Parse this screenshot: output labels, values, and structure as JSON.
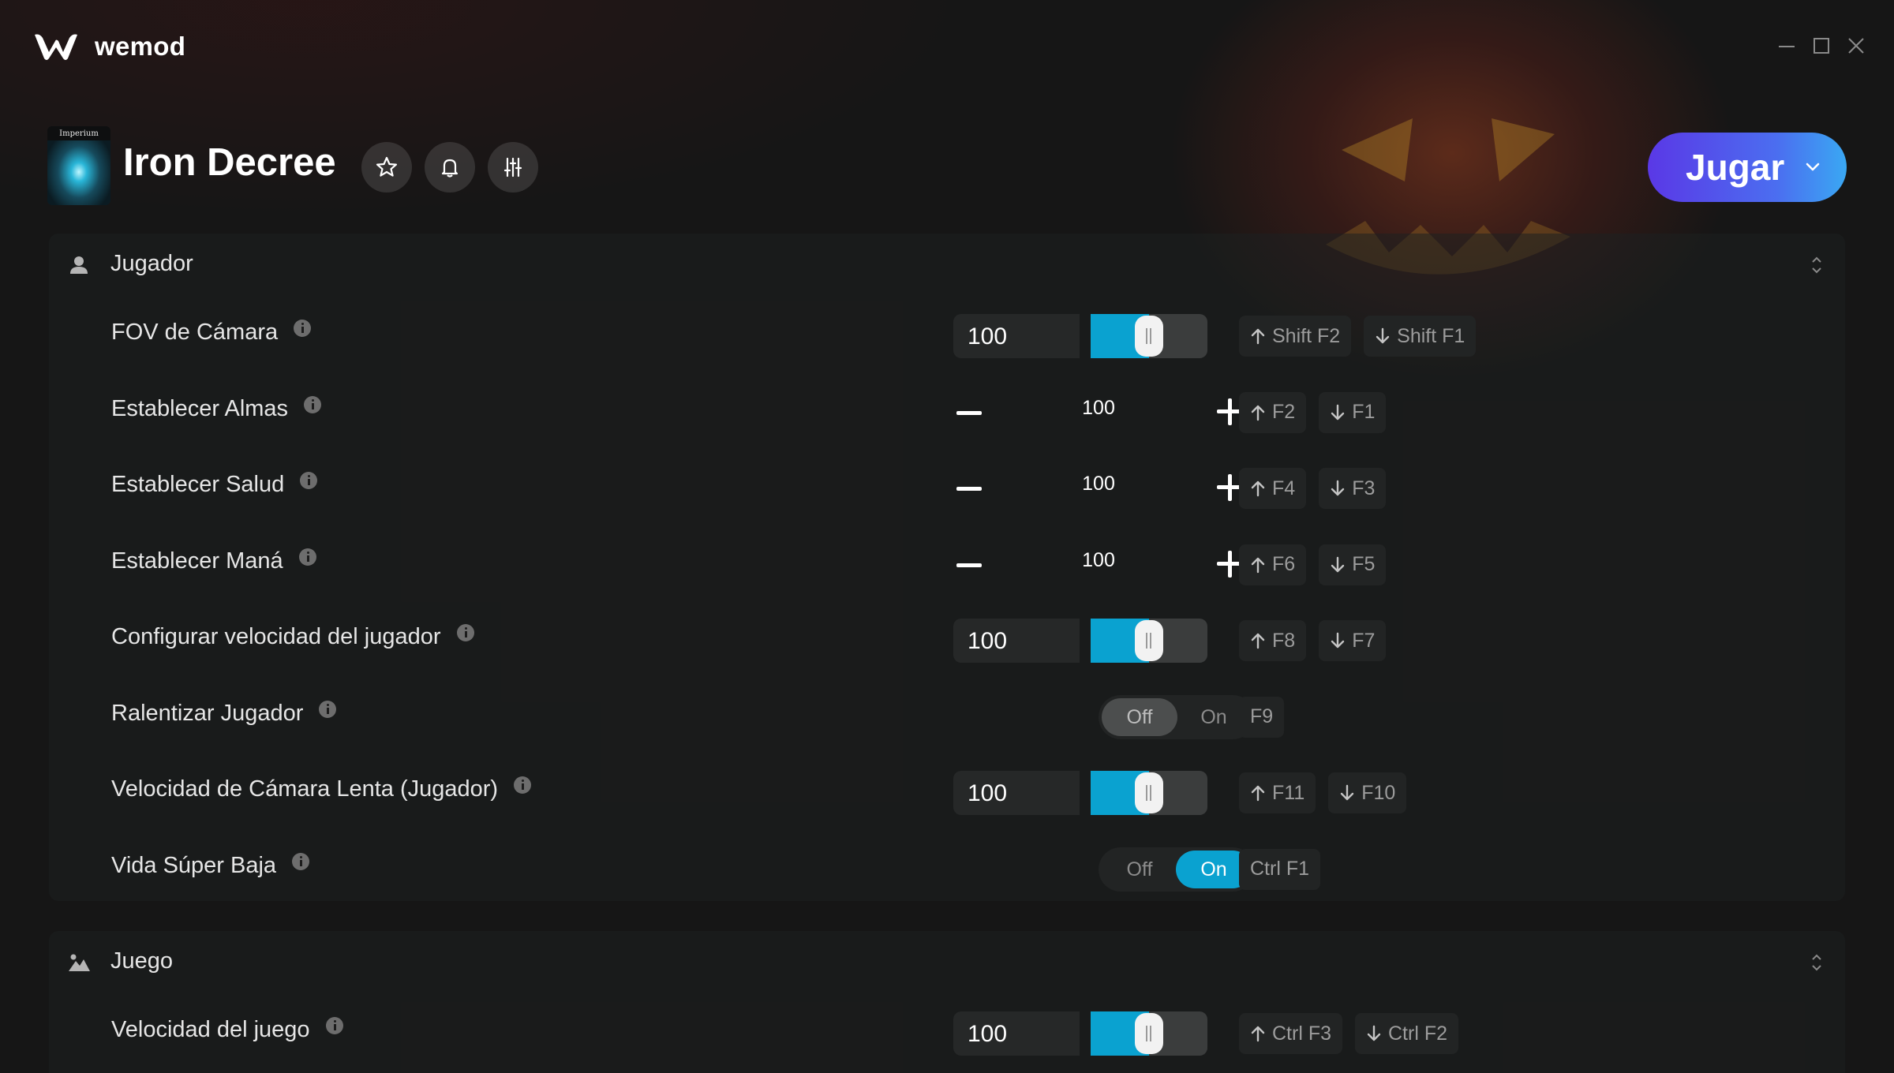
{
  "app": {
    "brand": "wemod"
  },
  "window_controls": [
    "minimize-icon",
    "maximize-icon",
    "close-icon"
  ],
  "header": {
    "game_title": "Iron Decree",
    "icon_caption": "Imperium",
    "buttons": [
      "star-icon",
      "bell-icon",
      "sliders-icon"
    ],
    "play_label": "Jugar"
  },
  "colors": {
    "accent": "#0aa2d0",
    "play_start": "#5a38e6",
    "play_end": "#3aa8f3",
    "background": "#161616"
  },
  "sections": [
    {
      "title": "Jugador",
      "icon": "user-icon",
      "rows": [
        {
          "label": "FOV de Cámara",
          "type": "slider",
          "value": "100",
          "fill": 0.5,
          "keys": [
            {
              "arrow": "up",
              "label": "Shift F2"
            },
            {
              "arrow": "down",
              "label": "Shift F1"
            }
          ]
        },
        {
          "label": "Establecer Almas",
          "type": "stepper",
          "value": "100",
          "keys": [
            {
              "arrow": "up",
              "label": "F2"
            },
            {
              "arrow": "down",
              "label": "F1"
            }
          ]
        },
        {
          "label": "Establecer Salud",
          "type": "stepper",
          "value": "100",
          "keys": [
            {
              "arrow": "up",
              "label": "F4"
            },
            {
              "arrow": "down",
              "label": "F3"
            }
          ]
        },
        {
          "label": "Establecer Maná",
          "type": "stepper",
          "value": "100",
          "keys": [
            {
              "arrow": "up",
              "label": "F6"
            },
            {
              "arrow": "down",
              "label": "F5"
            }
          ]
        },
        {
          "label": "Configurar velocidad del jugador",
          "type": "slider",
          "value": "100",
          "fill": 0.5,
          "keys": [
            {
              "arrow": "up",
              "label": "F8"
            },
            {
              "arrow": "down",
              "label": "F7"
            }
          ]
        },
        {
          "label": "Ralentizar Jugador",
          "type": "toggle",
          "off_label": "Off",
          "on_label": "On",
          "state": "off",
          "keys": [
            {
              "arrow": "",
              "label": "F9"
            }
          ]
        },
        {
          "label": "Velocidad de Cámara Lenta (Jugador)",
          "type": "slider",
          "value": "100",
          "fill": 0.5,
          "keys": [
            {
              "arrow": "up",
              "label": "F11"
            },
            {
              "arrow": "down",
              "label": "F10"
            }
          ]
        },
        {
          "label": "Vida Súper Baja",
          "type": "toggle",
          "off_label": "Off",
          "on_label": "On",
          "state": "on",
          "keys": [
            {
              "arrow": "",
              "label": "Ctrl F1"
            }
          ]
        }
      ]
    },
    {
      "title": "Juego",
      "icon": "landscape-icon",
      "rows": [
        {
          "label": "Velocidad del juego",
          "type": "slider",
          "value": "100",
          "fill": 0.5,
          "keys": [
            {
              "arrow": "up",
              "label": "Ctrl F3"
            },
            {
              "arrow": "down",
              "label": "Ctrl F2"
            }
          ]
        }
      ]
    }
  ]
}
